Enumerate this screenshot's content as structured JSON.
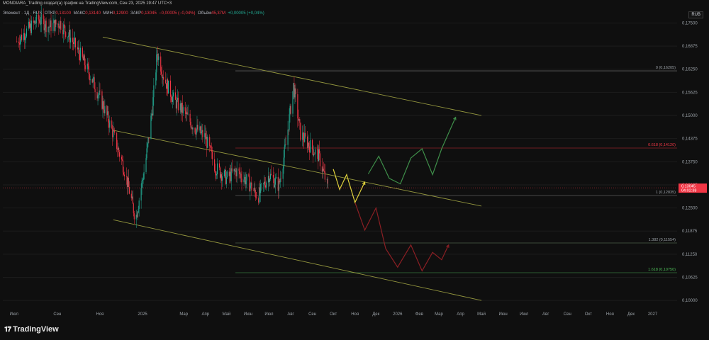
{
  "header": {
    "attribution": "MONDIARA_Trading создал(а) график на TradingView.com, Сен 23, 2025 19:47 UTC+3",
    "instrument": "Элемент · 1Д · RUS",
    "open_label": "ОТКР",
    "open_value": "0,13100",
    "high_label": "МАКС",
    "high_value": "0,13140",
    "low_label": "МИН",
    "low_value": "0,12900",
    "close_label": "ЗАКР",
    "close_value": "0,13045",
    "change": "−0,00005 (−0,04%)",
    "volume_label": "Объём",
    "volume_value": "45,37M",
    "volume_change": "+0,00005 (+0,04%)"
  },
  "currency": "RUB",
  "branding": "TradingView",
  "colors": {
    "background": "#0f0f0f",
    "up": "#22ab94",
    "down": "#f23645",
    "channel": "#b5b84a",
    "projection_yellow": "#e0d23c",
    "projection_green": "#3f8f4a",
    "projection_red": "#8b1f24",
    "axis_text": "#9aa0a6",
    "price_tag": "#f23645"
  },
  "chart_data": {
    "type": "candlestick",
    "x_axis_ticks": [
      "Июл",
      "Сен",
      "Ноя",
      "2025",
      "Мар",
      "Апр",
      "Май",
      "Июн",
      "Июл",
      "Авг",
      "Сен",
      "Окт",
      "Ноя",
      "Дек",
      "2026",
      "Фев",
      "Мар",
      "Апр",
      "Май",
      "Июн",
      "Июл",
      "Авг",
      "Сен",
      "Окт",
      "Ноя",
      "Дек",
      "2027"
    ],
    "y_axis_ticks": [
      "0,17500",
      "0,16875",
      "0,16250",
      "0,15625",
      "0,15000",
      "0,14375",
      "0,13750",
      "0,13125",
      "0,12500",
      "0,11875",
      "0,11250",
      "0,10625",
      "0,10000"
    ],
    "ylim": [
      0.0985,
      0.177
    ],
    "last_price": "0,13045",
    "countdown": "04:02:38",
    "fib_levels": [
      {
        "label": "0 (0,16205)",
        "value": 0.16205
      },
      {
        "label": "0.618 (0,14120)",
        "value": 0.1412
      },
      {
        "label": "1 (0,12835)",
        "value": 0.12835
      },
      {
        "label": "1.382 (0,11554)",
        "value": 0.11554
      },
      {
        "label": "1.618 (0,10750)",
        "value": 0.1075
      }
    ],
    "price_path": [
      [
        "2024-07-05",
        0.17
      ],
      [
        "2024-07-20",
        0.173
      ],
      [
        "2024-08-05",
        0.176
      ],
      [
        "2024-08-20",
        0.174
      ],
      [
        "2024-09-05",
        0.175
      ],
      [
        "2024-09-20",
        0.171
      ],
      [
        "2024-10-05",
        0.166
      ],
      [
        "2024-10-20",
        0.16
      ],
      [
        "2024-11-05",
        0.153
      ],
      [
        "2024-11-20",
        0.145
      ],
      [
        "2024-12-05",
        0.136
      ],
      [
        "2024-12-15",
        0.128
      ],
      [
        "2024-12-22",
        0.122
      ],
      [
        "2025-01-05",
        0.137
      ],
      [
        "2025-01-15",
        0.152
      ],
      [
        "2025-01-22",
        0.167
      ],
      [
        "2025-02-01",
        0.16
      ],
      [
        "2025-02-15",
        0.154
      ],
      [
        "2025-03-01",
        0.151
      ],
      [
        "2025-03-15",
        0.147
      ],
      [
        "2025-04-01",
        0.144
      ],
      [
        "2025-04-15",
        0.136
      ],
      [
        "2025-05-01",
        0.133
      ],
      [
        "2025-05-15",
        0.135
      ],
      [
        "2025-06-01",
        0.132
      ],
      [
        "2025-06-15",
        0.128
      ],
      [
        "2025-07-01",
        0.134
      ],
      [
        "2025-07-15",
        0.131
      ],
      [
        "2025-07-25",
        0.142
      ],
      [
        "2025-08-05",
        0.158
      ],
      [
        "2025-08-15",
        0.145
      ],
      [
        "2025-09-01",
        0.141
      ],
      [
        "2025-09-10",
        0.139
      ],
      [
        "2025-09-23",
        0.1305
      ]
    ],
    "projections": {
      "yellow": [
        [
          "2025-10-01",
          0.1355
        ],
        [
          "2025-10-10",
          0.13
        ],
        [
          "2025-10-20",
          0.134
        ],
        [
          "2025-11-01",
          0.1265
        ],
        [
          "2025-11-15",
          0.132
        ]
      ],
      "green": [
        [
          "2025-11-20",
          0.1342
        ],
        [
          "2025-12-05",
          0.139
        ],
        [
          "2025-12-20",
          0.133
        ],
        [
          "2026-01-05",
          0.1315
        ],
        [
          "2026-01-20",
          0.1385
        ],
        [
          "2026-02-05",
          0.141
        ],
        [
          "2026-02-20",
          0.134
        ],
        [
          "2026-03-05",
          0.141
        ],
        [
          "2026-03-25",
          0.1495
        ]
      ],
      "red": [
        [
          "2025-11-01",
          0.1265
        ],
        [
          "2025-11-15",
          0.119
        ],
        [
          "2025-12-01",
          0.125
        ],
        [
          "2025-12-15",
          0.114
        ],
        [
          "2026-01-01",
          0.109
        ],
        [
          "2026-01-20",
          0.115
        ],
        [
          "2026-02-05",
          0.108
        ],
        [
          "2026-02-20",
          0.113
        ],
        [
          "2026-03-05",
          0.111
        ],
        [
          "2026-03-15",
          0.115
        ]
      ]
    },
    "channel_lines": [
      {
        "name": "upper",
        "from": [
          "2024-11-05",
          0.1712
        ],
        "to": [
          "2026-05-01",
          0.15
        ]
      },
      {
        "name": "middle",
        "from": [
          "2024-11-20",
          0.146
        ],
        "to": [
          "2026-05-01",
          0.1255
        ]
      },
      {
        "name": "lower",
        "from": [
          "2024-11-20",
          0.1218
        ],
        "to": [
          "2026-05-01",
          0.1
        ]
      }
    ]
  }
}
